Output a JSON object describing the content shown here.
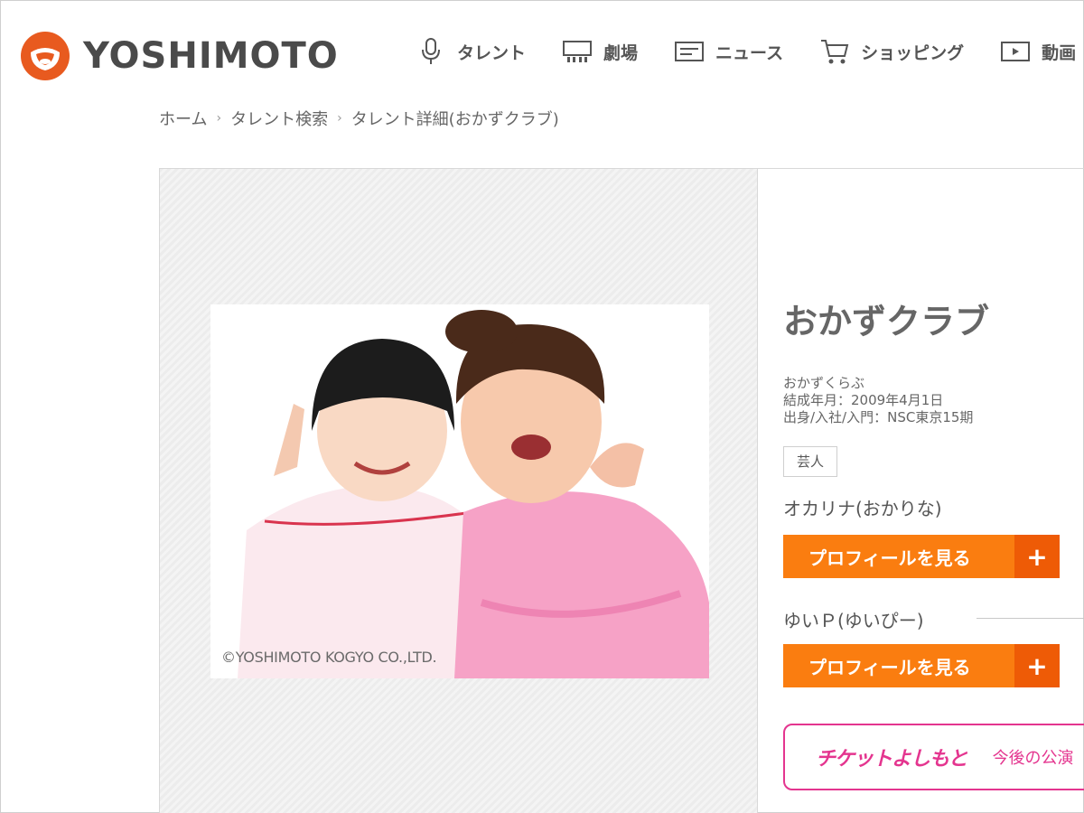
{
  "brand": {
    "name": "YOSHIMOTO",
    "accent": "#e85a1f"
  },
  "nav": {
    "items": [
      {
        "label": "タレント",
        "icon": "microphone-icon"
      },
      {
        "label": "劇場",
        "icon": "theater-icon"
      },
      {
        "label": "ニュース",
        "icon": "news-icon"
      },
      {
        "label": "ショッピング",
        "icon": "cart-icon"
      },
      {
        "label": "動画",
        "icon": "video-icon"
      }
    ]
  },
  "breadcrumb": [
    "ホーム",
    "タレント検索",
    "タレント詳細(おかずクラブ)"
  ],
  "photo": {
    "caption": "©YOSHIMOTO KOGYO CO.,LTD."
  },
  "talent": {
    "name": "おかずクラブ",
    "reading": "おかずくらぶ",
    "formed": "結成年月：2009年4月1日",
    "origin": "出身/入社/入門：NSC東京15期",
    "tag": "芸人",
    "members": [
      {
        "name": "オカリナ(おかりな)",
        "button_label": "プロフィールを見る",
        "plus": "+"
      },
      {
        "name": "ゆいＰ(ゆいぴー)",
        "button_label": "プロフィールを見る",
        "plus": "+"
      }
    ]
  },
  "ticket": {
    "logo": "チケットよしもと",
    "text": "今後の公演"
  },
  "colors": {
    "orange_button": "#fa7d10",
    "orange_plus": "#ee5b06",
    "ticket_pink": "#e4358f"
  }
}
